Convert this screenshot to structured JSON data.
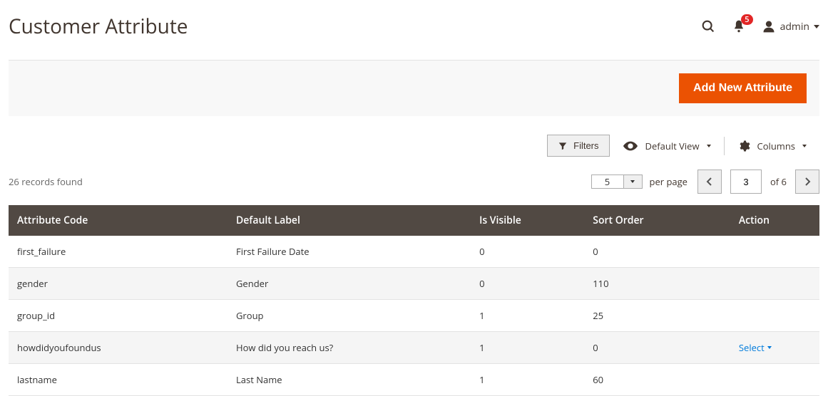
{
  "header": {
    "title": "Customer Attribute",
    "notification_count": "5",
    "admin_label": "admin"
  },
  "action_bar": {
    "add_button": "Add New Attribute"
  },
  "toolbar": {
    "filters_label": "Filters",
    "default_view_label": "Default View",
    "columns_label": "Columns"
  },
  "pager": {
    "records_found": "26 records found",
    "per_page_value": "5",
    "per_page_label": "per page",
    "current_page": "3",
    "of_pages": "of 6"
  },
  "table": {
    "headers": {
      "code": "Attribute Code",
      "label": "Default Label",
      "visible": "Is Visible",
      "sort": "Sort Order",
      "action": "Action"
    },
    "rows": [
      {
        "code": "first_failure",
        "label": "First Failure Date",
        "visible": "0",
        "sort": "0",
        "action": ""
      },
      {
        "code": "gender",
        "label": "Gender",
        "visible": "0",
        "sort": "110",
        "action": ""
      },
      {
        "code": "group_id",
        "label": "Group",
        "visible": "1",
        "sort": "25",
        "action": ""
      },
      {
        "code": "howdidyoufoundus",
        "label": "How did you reach us?",
        "visible": "1",
        "sort": "0",
        "action": "Select"
      },
      {
        "code": "lastname",
        "label": "Last Name",
        "visible": "1",
        "sort": "60",
        "action": ""
      }
    ]
  }
}
